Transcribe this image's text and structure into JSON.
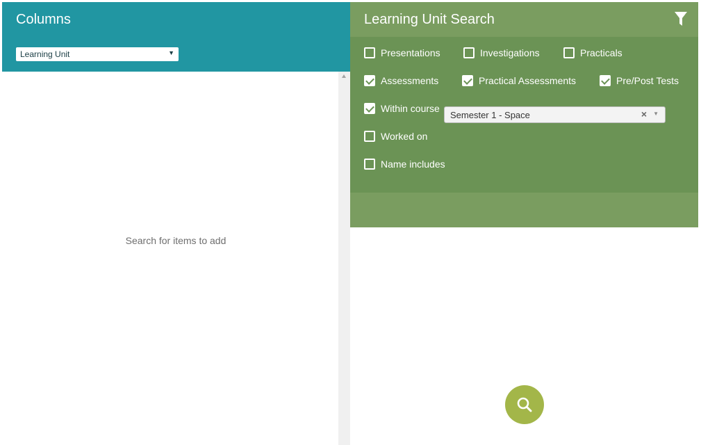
{
  "columns": {
    "title": "Columns",
    "type_select": {
      "value": "Learning Unit"
    },
    "empty_text": "Search for items to add"
  },
  "search": {
    "title": "Learning Unit Search",
    "filters": [
      {
        "label": "Presentations",
        "checked": false
      },
      {
        "label": "Investigations",
        "checked": false
      },
      {
        "label": "Practicals",
        "checked": false
      },
      {
        "label": "Assessments",
        "checked": true
      },
      {
        "label": "Practical Assessments",
        "checked": true
      },
      {
        "label": "Pre/Post Tests",
        "checked": true
      },
      {
        "label": "Within course",
        "checked": true
      },
      {
        "label": "Worked on",
        "checked": false
      },
      {
        "label": "Name includes",
        "checked": false
      }
    ],
    "course_select": {
      "value": "Semester 1 - Space"
    }
  },
  "icons": {
    "filter": "filter-icon",
    "search": "search-icon",
    "clear": "clear-icon",
    "dropdown": "chevron-down-icon"
  },
  "colors": {
    "teal": "#2196a2",
    "green_header": "#7a9d60",
    "green_filters": "#6b9355",
    "search_button": "#a3b649"
  }
}
